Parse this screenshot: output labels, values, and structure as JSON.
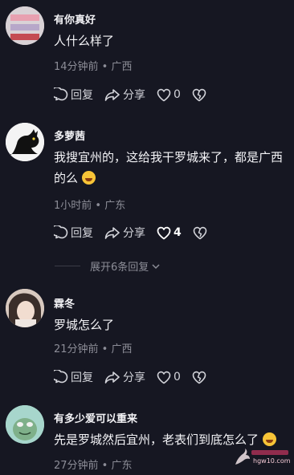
{
  "comments": [
    {
      "username": "有你真好",
      "text": "人什么样了",
      "meta": "14分钟前 • 广西",
      "reply_label": "回复",
      "share_label": "分享",
      "likes": "0"
    },
    {
      "username": "多萝茜",
      "text_line1": "我搜宜州的，这给我干罗城来了，都是广西",
      "text_line2": "的么",
      "meta": "1小时前 • 广东",
      "reply_label": "回复",
      "share_label": "分享",
      "likes": "4"
    },
    {
      "username": "霖冬",
      "text": "罗城怎么了",
      "meta": "21分钟前 • 广西",
      "reply_label": "回复",
      "share_label": "分享",
      "likes": "0"
    },
    {
      "username": "有多少爱可以重来",
      "text": "先是罗城然后宜州，老表们到底怎么了",
      "meta": "27分钟前 • 广东"
    }
  ],
  "expand_replies": "展开6条回复",
  "watermark_text": "hgw10.com",
  "icons": {
    "reply": "reply-icon",
    "share": "share-icon",
    "like": "heart-icon",
    "dislike": "broken-heart-icon",
    "emoji": "laughing-tears-emoji-icon",
    "chevron": "chevron-down-icon"
  },
  "colors": {
    "background": "#161722",
    "meta_text": "#8c8d97"
  }
}
